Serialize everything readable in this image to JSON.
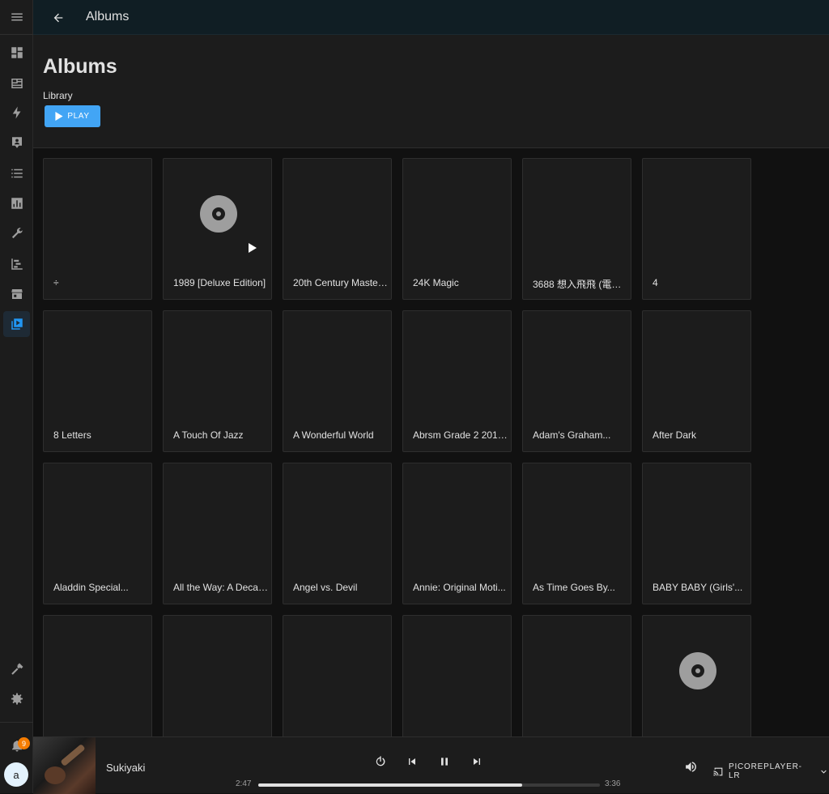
{
  "topbar": {
    "title": "Albums"
  },
  "header": {
    "title": "Albums",
    "subtitle": "Library",
    "play_label": "PLAY"
  },
  "albums": [
    {
      "title": "÷"
    },
    {
      "title": "1989 [Deluxe Edition]"
    },
    {
      "title": "20th Century Master..."
    },
    {
      "title": "24K Magic"
    },
    {
      "title": "3688 想入飛飛 (電影..."
    },
    {
      "title": "4"
    },
    {
      "title": "8 Letters"
    },
    {
      "title": "A Touch Of Jazz"
    },
    {
      "title": "A Wonderful World"
    },
    {
      "title": "Abrsm Grade 2 2015..."
    },
    {
      "title": "Adam's Graham..."
    },
    {
      "title": "After Dark"
    },
    {
      "title": "Aladdin Special..."
    },
    {
      "title": "All the Way: A Decad..."
    },
    {
      "title": "Angel vs. Devil"
    },
    {
      "title": "Annie: Original Moti..."
    },
    {
      "title": "As Time Goes By..."
    },
    {
      "title": "BABY BABY (Girls'..."
    },
    {
      "title": ""
    },
    {
      "title": ""
    },
    {
      "title": ""
    },
    {
      "title": ""
    },
    {
      "title": ""
    },
    {
      "title": ""
    }
  ],
  "sidebar": {
    "notification_count": "9",
    "avatar_initial": "a"
  },
  "player": {
    "track": "Sukiyaki",
    "elapsed": "2:47",
    "duration": "3:36",
    "progress_fraction": 0.773,
    "device": "PICOREPLAYER-LR"
  },
  "colors": {
    "accent": "#2196f3",
    "play_button": "#42a5f5",
    "badge": "#f57c00"
  }
}
